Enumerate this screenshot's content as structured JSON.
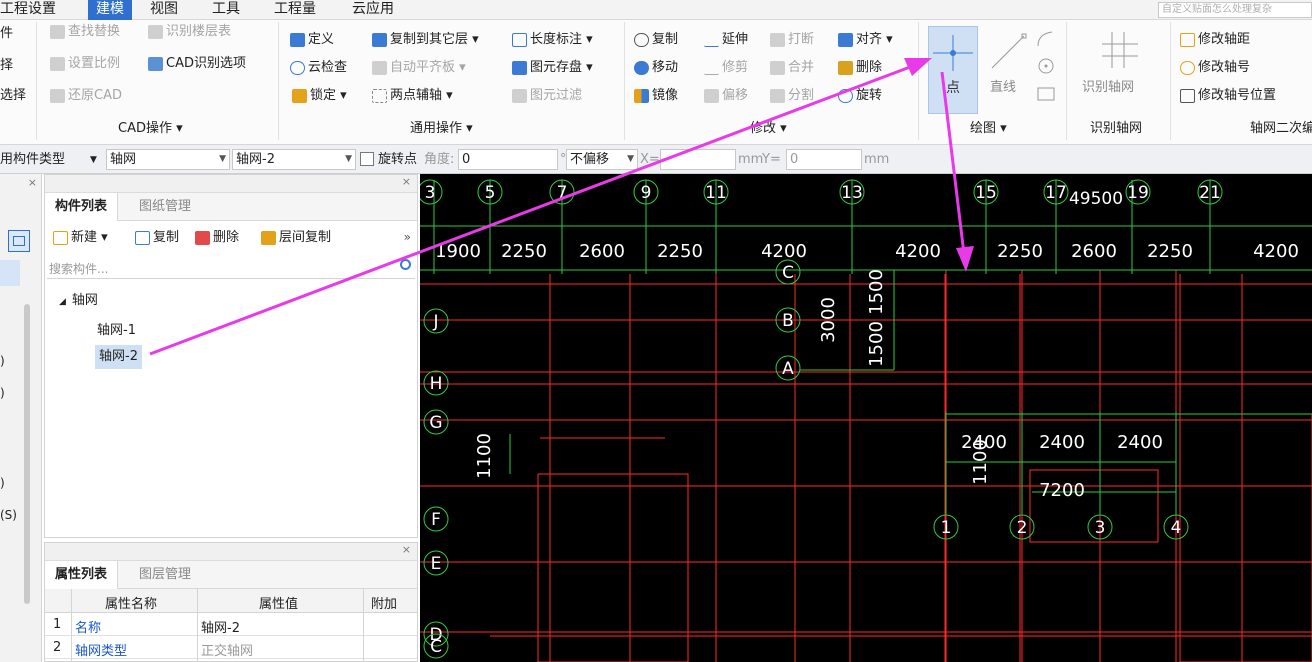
{
  "menubar": {
    "items": [
      "工程设置",
      "建模",
      "视图",
      "工具",
      "工程量",
      "云应用"
    ],
    "active_index": 1,
    "search_placeholder": "自定义贴面怎么处理复杂"
  },
  "ribbon": {
    "left_cut": [
      "件",
      "择",
      "选择"
    ],
    "cad": {
      "find_replace": "查找替换",
      "recognize_floor_table": "识别楼层表",
      "set_scale": "设置比例",
      "cad_recognize_options": "CAD识别选项",
      "restore_cad": "还原CAD",
      "group_label": "CAD操作 ▾"
    },
    "general": {
      "define": "定义",
      "copy_to_other_floor": "复制到其它层 ▾",
      "length_mark": "长度标注 ▾",
      "cloud_check": "云检查",
      "auto_flat_slab": "自动平齐板 ▾",
      "element_save": "图元存盘 ▾",
      "lock": "锁定 ▾",
      "two_point_axis": "两点辅轴 ▾",
      "element_filter": "图元过滤",
      "group_label": "通用操作 ▾"
    },
    "modify": {
      "copy": "复制",
      "extend": "延伸",
      "break": "打断",
      "align": "对齐 ▾",
      "move": "移动",
      "trim": "修剪",
      "merge": "合并",
      "delete": "删除",
      "mirror": "镜像",
      "offset": "偏移",
      "split": "分割",
      "rotate": "旋转",
      "group_label": "修改 ▾"
    },
    "draw": {
      "point": "点",
      "line": "直线",
      "group_label": "绘图 ▾"
    },
    "recognize_axis": {
      "button": "识别轴网",
      "group_label": "识别轴网"
    },
    "axis_edit": {
      "modify_spacing": "修改轴距",
      "modify_number": "修改轴号",
      "modify_number_position": "修改轴号位置",
      "group_label": "轴网二次编"
    }
  },
  "propbar": {
    "type_label": "用构件类型",
    "type_value": "轴网",
    "element_value": "轴网-2",
    "rotate_point": "旋转点",
    "angle_label": "角度:",
    "angle_value": "0",
    "degree": "°",
    "offset_value": "不偏移",
    "x_label": "X=",
    "mm_x": "mm",
    "y_label": "Y=",
    "y_value": "0",
    "mm_y": "mm"
  },
  "left_strip": {
    "cut_items": [
      ")",
      ")",
      ")",
      "(S)"
    ]
  },
  "component_panel": {
    "tabs": [
      "构件列表",
      "图纸管理"
    ],
    "toolbar": {
      "new": "新建 ▾",
      "copy": "复制",
      "delete": "删除",
      "floor_copy": "层间复制",
      "more": "»"
    },
    "search_placeholder": "搜索构件...",
    "tree": {
      "root": "轴网",
      "items": [
        "轴网-1",
        "轴网-2"
      ],
      "selected_index": 1
    }
  },
  "property_panel": {
    "tabs": [
      "属性列表",
      "图层管理"
    ],
    "headers": [
      "属性名称",
      "属性值",
      "附加"
    ],
    "rows": [
      {
        "num": "1",
        "name": "名称",
        "value": "轴网-2"
      },
      {
        "num": "2",
        "name": "轴网类型",
        "value": "正交轴网"
      }
    ]
  },
  "drawing": {
    "top_axis_numbers": [
      "3",
      "5",
      "7",
      "9",
      "11",
      "13",
      "15",
      "17",
      "19",
      "21"
    ],
    "total_length": "49500",
    "top_dims": [
      "1900",
      "2250",
      "2600",
      "2250",
      "4200",
      "4200",
      "2250",
      "2600",
      "2250",
      "4200"
    ],
    "left_axis_letters": [
      "J",
      "H",
      "G",
      "F",
      "E",
      "D",
      "C"
    ],
    "inner_letters": [
      "C",
      "B",
      "A"
    ],
    "inner_vertical_dims": [
      "3000",
      "1500",
      "1500"
    ],
    "left_vertical_dim": "1100",
    "new_grid_dims": [
      "2400",
      "2400",
      "2400"
    ],
    "new_grid_vertical_dim": "1100",
    "new_grid_total": "7200",
    "new_grid_numbers": [
      "1",
      "2",
      "3",
      "4"
    ],
    "colors": {
      "background": "#000000",
      "axis_line": "#ff2a2a",
      "dim_line": "#2ecc40",
      "text": "#ffffff",
      "annotation": "#e83ae8"
    }
  },
  "colors": {
    "ribbon_active_tab": "#2f6fd0",
    "selection": "#cfe0f5",
    "link_text": "#1a56c7"
  }
}
